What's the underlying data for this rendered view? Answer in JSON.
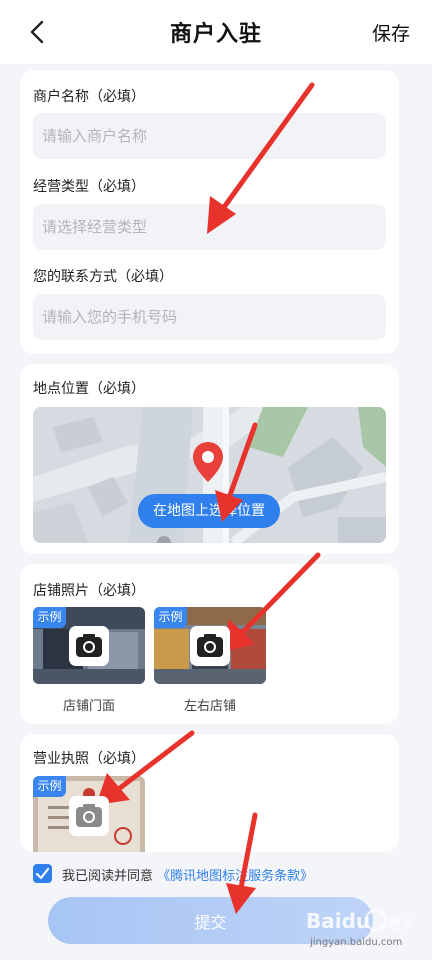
{
  "header": {
    "title": "商户入驻",
    "save_label": "保存"
  },
  "form": {
    "name_label": "商户名称（必填）",
    "name_placeholder": "请输入商户名称",
    "type_label": "经营类型（必填）",
    "type_placeholder": "请选择经营类型",
    "contact_label": "您的联系方式（必填）",
    "contact_placeholder": "请输入您的手机号码"
  },
  "location": {
    "label": "地点位置（必填）",
    "button_label": "在地图上选择位置"
  },
  "store_photos": {
    "label": "店铺照片（必填）",
    "items": [
      {
        "badge": "示例",
        "caption": "店铺门面"
      },
      {
        "badge": "示例",
        "caption": "左右店铺"
      }
    ]
  },
  "license": {
    "label": "营业执照（必填）",
    "badge": "示例"
  },
  "agreement": {
    "prefix": "我已阅读并同意",
    "link": "《腾讯地图标注服务条款》"
  },
  "submit_label": "提交",
  "watermark": {
    "brand": "Baidu",
    "sub": "经验",
    "url": "jingyan.baidu.com"
  },
  "colors": {
    "accent": "#2f80ed",
    "arrow": "#e8322c",
    "background": "#f4f5f9"
  }
}
